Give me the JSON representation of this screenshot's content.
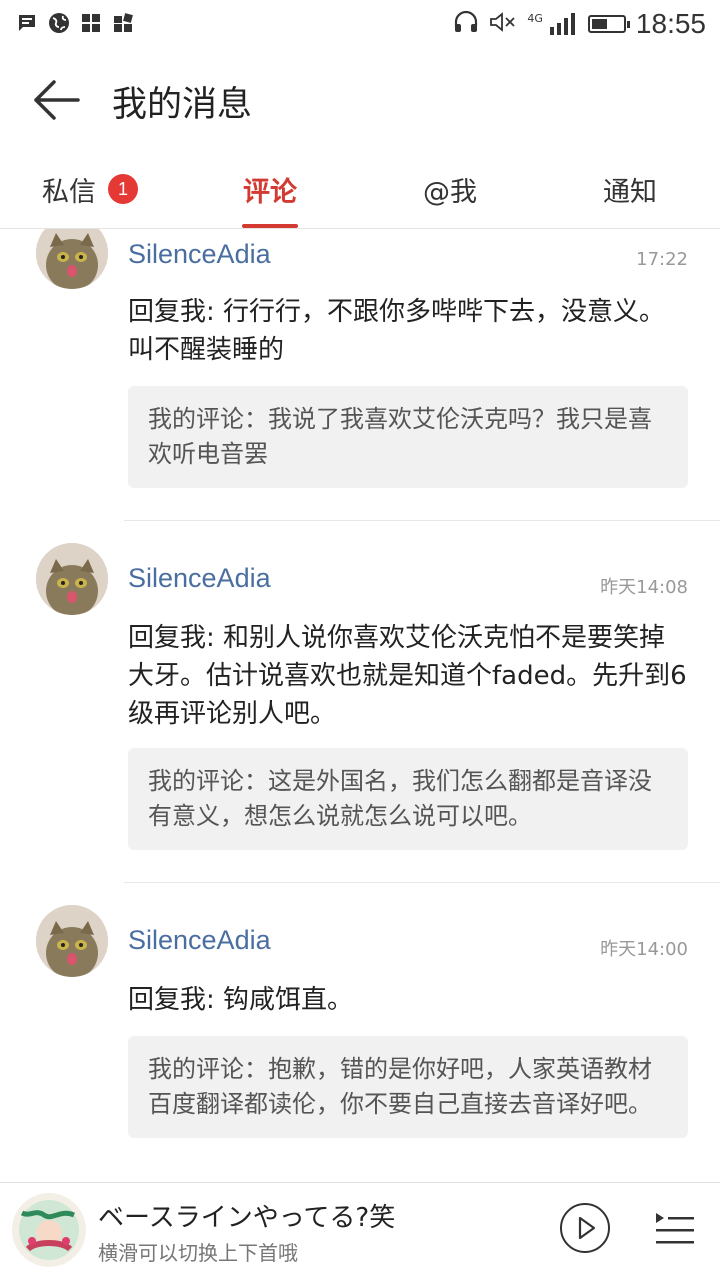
{
  "status_bar": {
    "time": "18:55",
    "icons": [
      "message-icon",
      "globe-icon",
      "app-grid-icon",
      "app-grid-icon",
      "headphones-icon",
      "mute-icon",
      "signal-4g-icon",
      "battery-icon"
    ],
    "network": "4G",
    "battery_level": 0.5
  },
  "header": {
    "title": "我的消息",
    "back_icon": "arrow-left-icon"
  },
  "tabs": [
    {
      "label": "私信",
      "badge": "1"
    },
    {
      "label": "评论",
      "active": true
    },
    {
      "label": "@我"
    },
    {
      "label": "通知"
    }
  ],
  "accent_color": "#d33a31",
  "comments": [
    {
      "user": "SilenceAdia",
      "time": "17:22",
      "reply": "回复我: 行行行，不跟你多哔哔下去，没意义。叫不醒装睡的",
      "my_comment": "我的评论：我说了我喜欢艾伦沃克吗？我只是喜欢听电音罢"
    },
    {
      "user": "SilenceAdia",
      "time": "昨天14:08",
      "reply": "回复我: 和别人说你喜欢艾伦沃克怕不是要笑掉大牙。估计说喜欢也就是知道个faded。先升到6级再评论别人吧。",
      "my_comment": "我的评论：这是外国名，我们怎么翻都是音译没有意义，想怎么说就怎么说可以吧。"
    },
    {
      "user": "SilenceAdia",
      "time": "昨天14:00",
      "reply": "回复我: 钩咸饵直。",
      "my_comment": "我的评论：抱歉，错的是你好吧，人家英语教材百度翻译都读伦，你不要自己直接去音译好吧。"
    }
  ],
  "player": {
    "song": "ベースラインやってる?笑",
    "hint": "横滑可以切换上下首哦",
    "play_icon": "play-icon",
    "queue_icon": "playlist-icon"
  }
}
